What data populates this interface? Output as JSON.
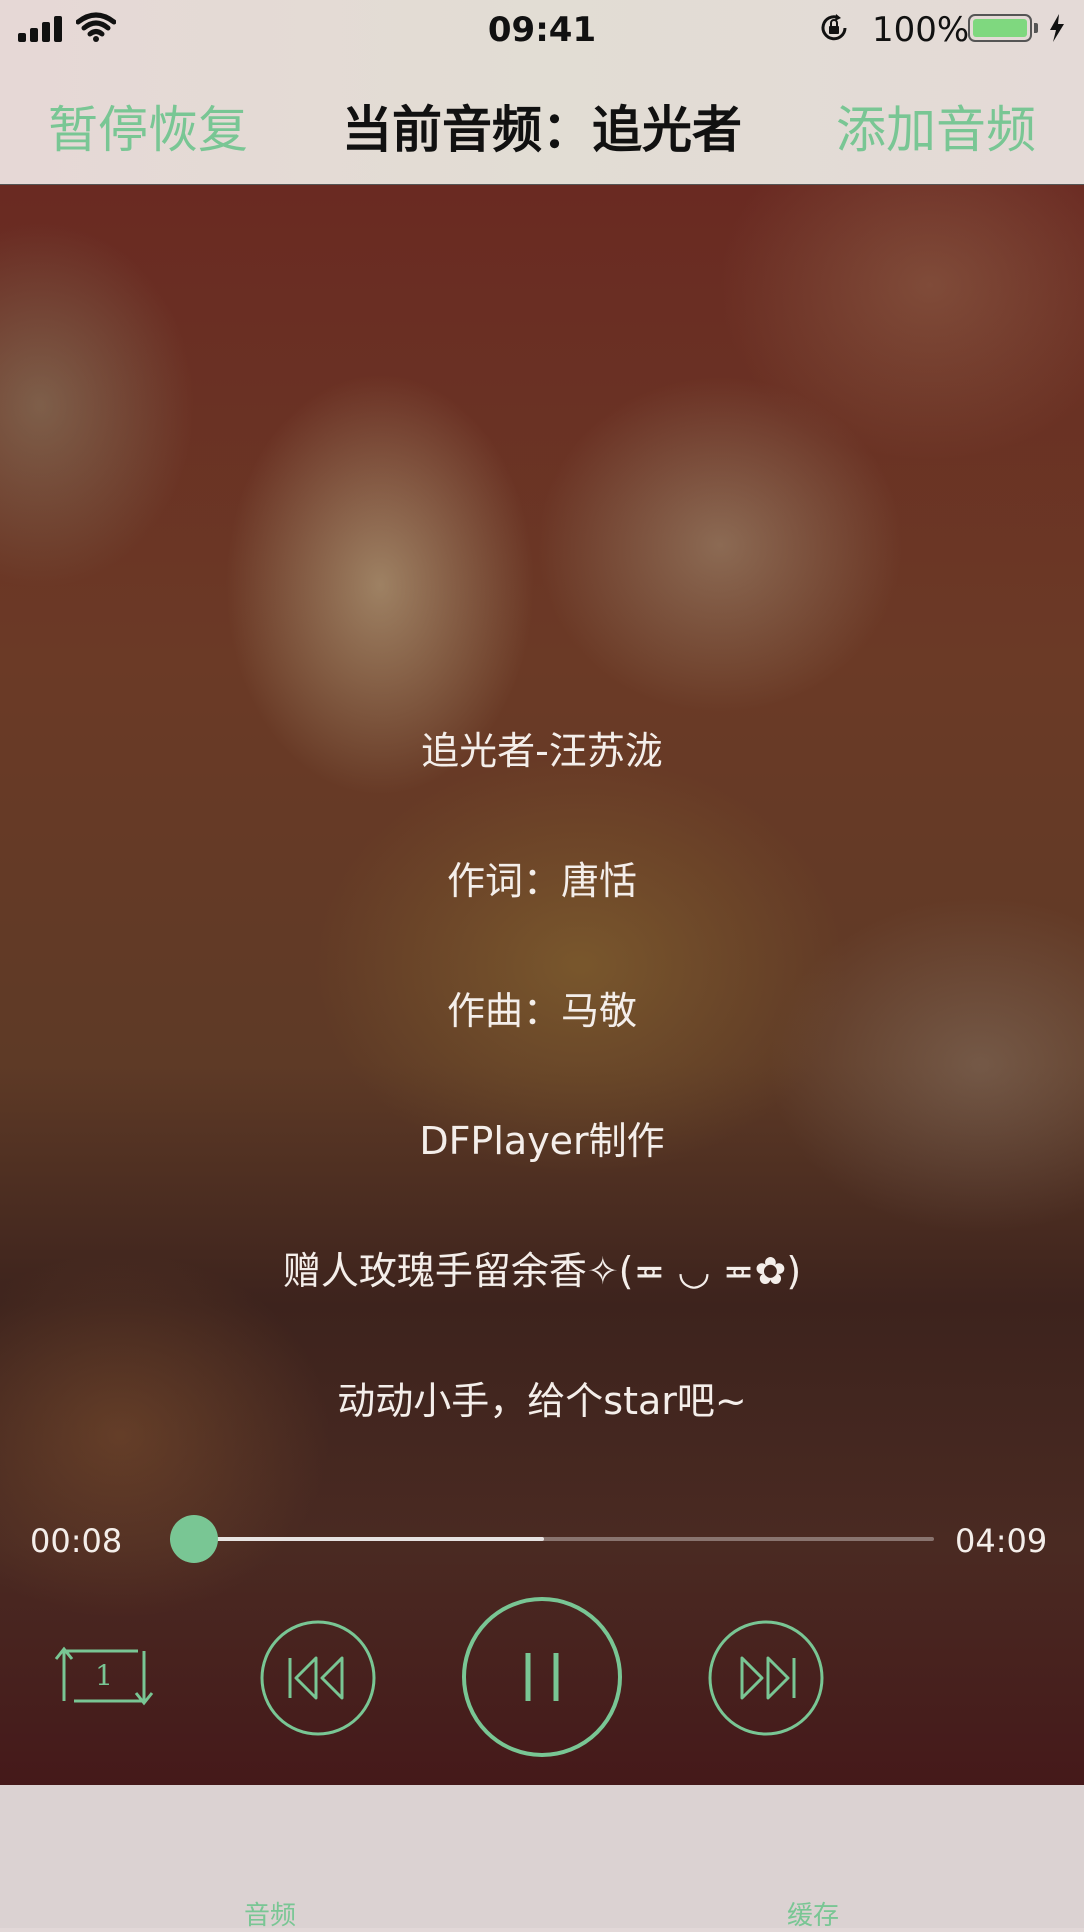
{
  "status_bar": {
    "time": "09:41",
    "battery_percent_text": "100%",
    "battery_level": 1.0,
    "battery_color": "#7fd87f",
    "icons": [
      "cellular-signal-icon",
      "wifi-icon",
      "orientation-lock-icon",
      "battery-icon",
      "charging-bolt-icon"
    ]
  },
  "nav": {
    "left_button": "暂停恢复",
    "title": "当前音频：追光者",
    "right_button": "添加音频",
    "accent_color": "#79c694"
  },
  "lyrics": [
    "追光者-汪苏泷",
    "作词：唐恬",
    "作曲：马敬",
    "DFPlayer制作",
    "赠人玫瑰手留余香✧(≖ ◡ ≖✿)",
    "动动小手，给个star吧~"
  ],
  "progress": {
    "current_time": "00:08",
    "total_time": "04:09",
    "played_fraction": 0.032,
    "buffered_fraction": 0.49
  },
  "controls": {
    "repeat_mode": "single-repeat",
    "icons": [
      "repeat-one-icon",
      "previous-track-icon",
      "pause-icon",
      "next-track-icon"
    ],
    "state": "playing"
  },
  "tabs": [
    {
      "label": "音频",
      "selected": true
    },
    {
      "label": "缓存",
      "selected": false
    }
  ]
}
